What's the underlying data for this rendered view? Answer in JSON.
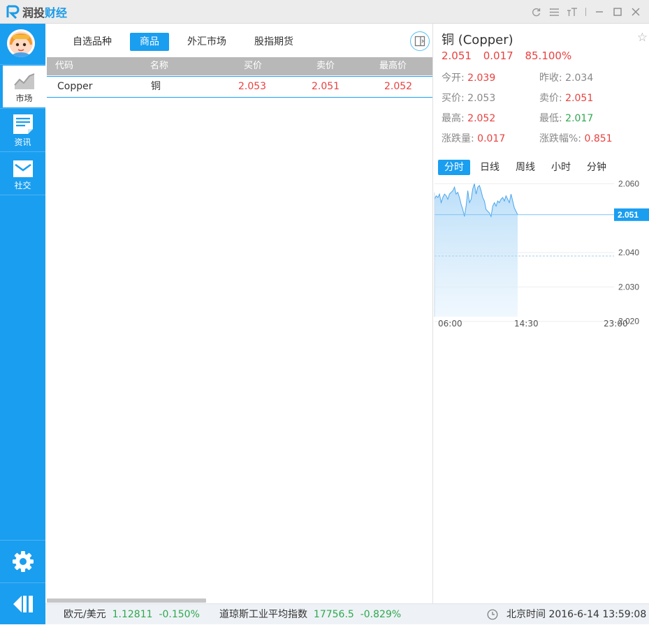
{
  "app": {
    "title_plain": "润投",
    "title_highlight": "财经"
  },
  "window_controls": [
    "refresh-icon",
    "list-icon",
    "font-size-icon",
    "minimize-icon",
    "maximize-icon",
    "close-icon"
  ],
  "colors": {
    "accent": "#1a9ef0",
    "up": "#e8413f",
    "down": "#2fa84f"
  },
  "sidebar": {
    "items": [
      {
        "label": "市场",
        "icon": "market-chart-icon",
        "active": true
      },
      {
        "label": "资讯",
        "icon": "news-icon",
        "active": false
      },
      {
        "label": "社交",
        "icon": "mail-icon",
        "active": false
      }
    ],
    "settings_icon": "gear-icon",
    "collapse_icon": "collapse-left-icon"
  },
  "market": {
    "tabs": [
      {
        "label": "自选品种",
        "active": false
      },
      {
        "label": "商品",
        "active": true
      },
      {
        "label": "外汇市场",
        "active": false
      },
      {
        "label": "股指期货",
        "active": false
      }
    ],
    "columns": [
      "代码",
      "名称",
      "买价",
      "卖价",
      "最高价"
    ],
    "rows": [
      {
        "code": "Copper",
        "name": "铜",
        "bid": "2.053",
        "ask": "2.051",
        "high": "2.052"
      }
    ]
  },
  "detail": {
    "title": "铜  (Copper)",
    "price": "2.051",
    "change": "0.017",
    "change_pct": "85.100%",
    "open_label": "今开:",
    "open": "2.039",
    "prev_close_label": "昨收:",
    "prev_close": "2.034",
    "bid_label": "买价:",
    "bid": "2.053",
    "ask_label": "卖价:",
    "ask": "2.051",
    "high_label": "最高:",
    "high": "2.052",
    "low_label": "最低:",
    "low": "2.017",
    "chg_label": "涨跌量:",
    "chg": "0.017",
    "chg_pct_label": "涨跌幅%:",
    "chg_pct": "0.851",
    "period_tabs": [
      {
        "label": "分时",
        "active": true
      },
      {
        "label": "日线",
        "active": false
      },
      {
        "label": "周线",
        "active": false
      },
      {
        "label": "小时",
        "active": false
      },
      {
        "label": "分钟",
        "active": false
      }
    ]
  },
  "chart_data": {
    "type": "area",
    "y_ticks": [
      "2.060",
      "2.040",
      "2.030",
      "2.020"
    ],
    "ylim": [
      2.0165,
      2.0615
    ],
    "x_ticks": [
      "06:00",
      "14:30",
      "23:00"
    ],
    "current_price_label": "2.051",
    "current_price": 2.051,
    "reference_price": 2.039,
    "series": [
      {
        "values": [
          2.0555,
          2.0565,
          2.056,
          2.057,
          2.0545,
          2.056,
          2.057,
          2.0565,
          2.0555,
          2.057,
          2.0575,
          2.058,
          2.059,
          2.057,
          2.0575,
          2.056,
          2.054,
          2.0525,
          2.0505,
          2.0535,
          2.058,
          2.0545,
          2.0555,
          2.0585,
          2.06,
          2.057,
          2.059,
          2.0595,
          2.058,
          2.056,
          2.055,
          2.0525,
          2.052,
          2.0515,
          2.0505,
          2.0535,
          2.0545,
          2.0535,
          2.055,
          2.0545,
          2.0555,
          2.056,
          2.055,
          2.0565,
          2.0555,
          2.0545,
          2.057,
          2.055,
          2.053,
          2.052,
          2.051
        ]
      }
    ]
  },
  "statusbar": {
    "eurusd_label": "欧元/美元",
    "eurusd": "1.12811",
    "eurusd_chg": "-0.150%",
    "dow_label": "道琼斯工业平均指数",
    "dow": "17756.5",
    "dow_chg": "-0.829%",
    "clock_icon": "clock-icon",
    "time_label": "北京时间",
    "time": "2016-6-14 13:59:08"
  }
}
